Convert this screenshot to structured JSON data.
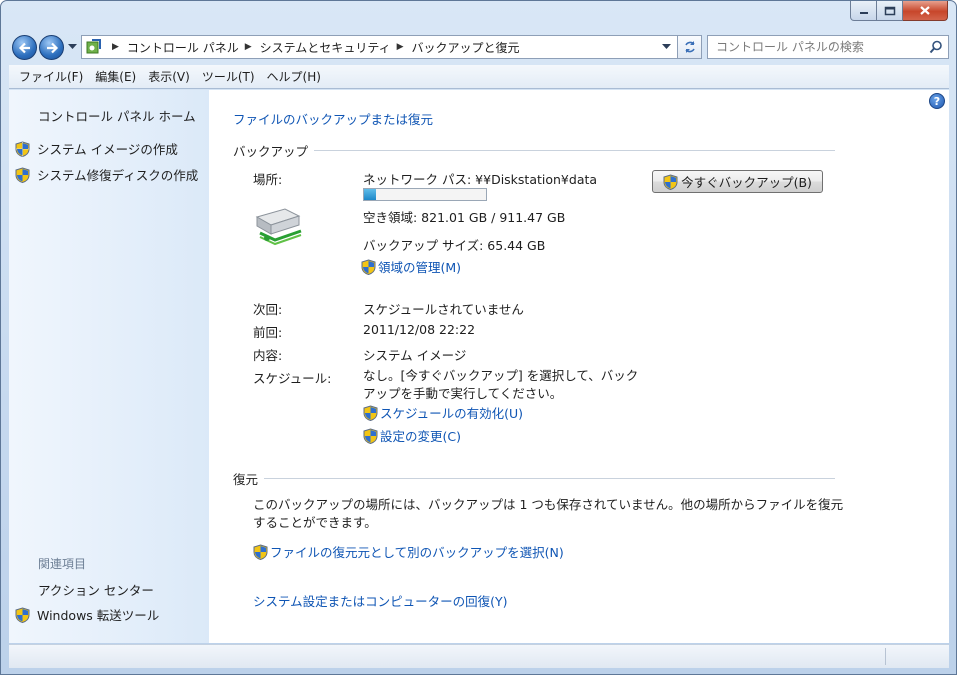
{
  "window": {
    "minimize_label": "Minimize",
    "maximize_label": "Maximize",
    "close_label": "Close"
  },
  "navigation": {
    "breadcrumb": [
      "コントロール パネル",
      "システムとセキュリティ",
      "バックアップと復元"
    ],
    "search_placeholder": "コントロール パネルの検索"
  },
  "menu": [
    "ファイル(F)",
    "編集(E)",
    "表示(V)",
    "ツール(T)",
    "ヘルプ(H)"
  ],
  "sidebar": {
    "home": "コントロール パネル ホーム",
    "tasks": [
      "システム イメージの作成",
      "システム修復ディスクの作成"
    ],
    "related_heading": "関連項目",
    "related": [
      "アクション センター",
      "Windows 転送ツール"
    ]
  },
  "main": {
    "title_link": "ファイルのバックアップまたは復元",
    "backup": {
      "heading": "バックアップ",
      "location_label": "場所:",
      "network_path": "ネットワーク パス: ¥¥Diskstation¥data",
      "usage_fraction": 0.1,
      "free_space": "空き領域: 821.01 GB / 911.47 GB",
      "backup_size": "バックアップ サイズ: 65.44 GB",
      "manage_space": "領域の管理(M)",
      "backup_now": "今すぐバックアップ(B)",
      "next_label": "次回:",
      "next_value": "スケジュールされていません",
      "last_label": "前回:",
      "last_value": "2011/12/08 22:22",
      "contents_label": "内容:",
      "contents_value": "システム イメージ",
      "schedule_label": "スケジュール:",
      "schedule_value": "なし。[今すぐバックアップ] を選択して、バックアップを手動で実行してください。",
      "enable_schedule": "スケジュールの有効化(U)",
      "change_settings": "設定の変更(C)"
    },
    "restore": {
      "heading": "復元",
      "message": "このバックアップの場所には、バックアップは 1 つも保存されていません。他の場所からファイルを復元することができます。",
      "select_other": "ファイルの復元元として別のバックアップを選択(N)",
      "recover_system": "システム設定またはコンピューターの回復(Y)"
    }
  },
  "colors": {
    "link": "#0f55b4",
    "sidebar_bg": "#dbe9f8",
    "progress_fill": "#1d88c8"
  }
}
